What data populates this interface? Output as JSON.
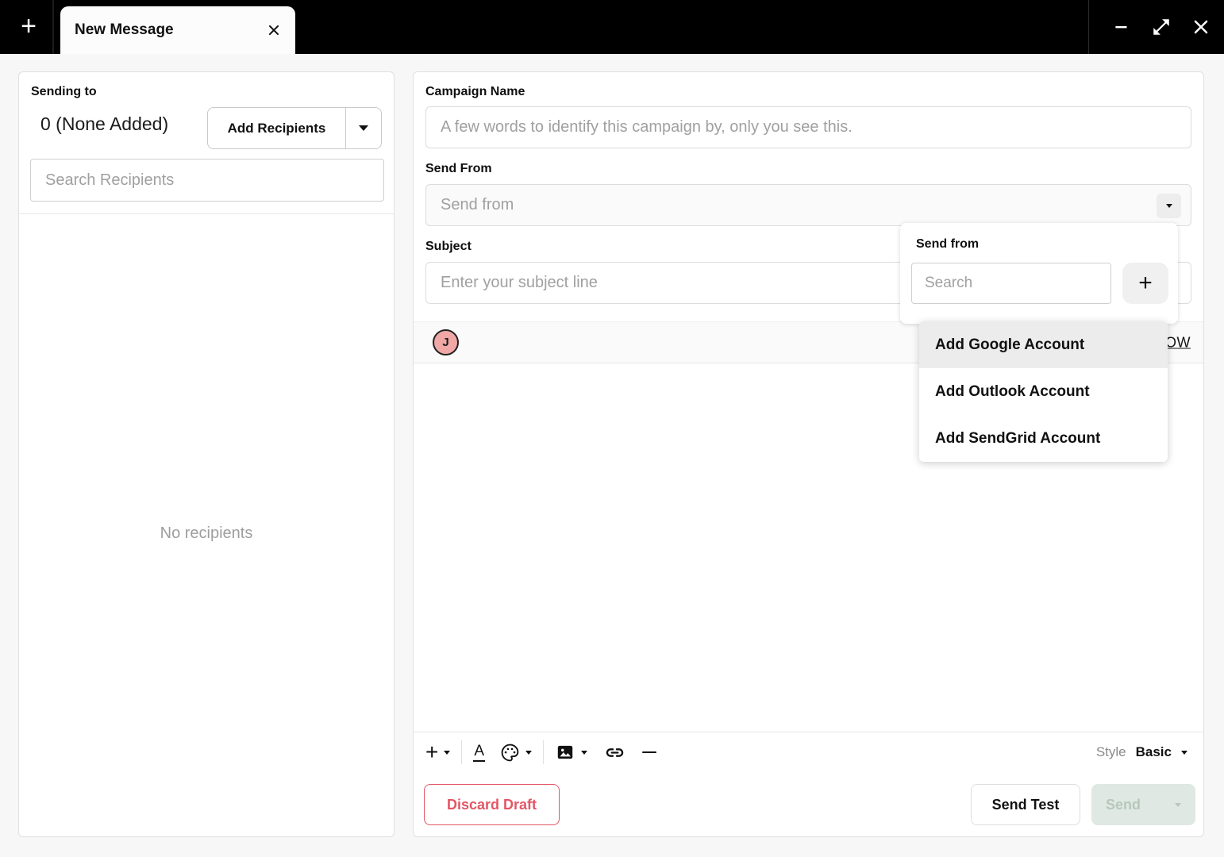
{
  "window": {
    "new_tab_glyph": "+",
    "tab_title": "New Message"
  },
  "recipients_panel": {
    "title": "Sending to",
    "count_text": "0 (None Added)",
    "add_recipients_button": "Add Recipients",
    "search_placeholder": "Search Recipients",
    "empty_state": "No recipients"
  },
  "compose": {
    "campaign_name_label": "Campaign Name",
    "campaign_name_placeholder": "A few words to identify this campaign by, only you see this.",
    "send_from_label": "Send From",
    "send_from_placeholder": "Send from",
    "subject_label": "Subject",
    "subject_placeholder": "Enter your subject line",
    "avatar_initial": "J",
    "partial_link_text": "OW"
  },
  "send_from_popup": {
    "title": "Send from",
    "search_placeholder": "Search",
    "add_button_glyph": "+",
    "menu_items": [
      "Add Google Account",
      "Add Outlook Account",
      "Add SendGrid Account"
    ],
    "highlighted_index": 0
  },
  "editor_toolbar": {
    "plus_glyph": "+",
    "text_color_glyph": "A",
    "style_label": "Style",
    "style_value": "Basic"
  },
  "footer": {
    "discard_button": "Discard Draft",
    "send_test_button": "Send Test",
    "send_button": "Send"
  },
  "colors": {
    "topbar_bg": "#000000",
    "page_bg": "#f7f7f7",
    "accent_red": "#e25666",
    "send_disabled_bg": "#dfe8e2",
    "send_disabled_text": "#b6c8bc",
    "avatar_bg": "#efa8a6",
    "placeholder_gray": "#a0a0a0",
    "menu_highlight_bg": "#ececec"
  }
}
